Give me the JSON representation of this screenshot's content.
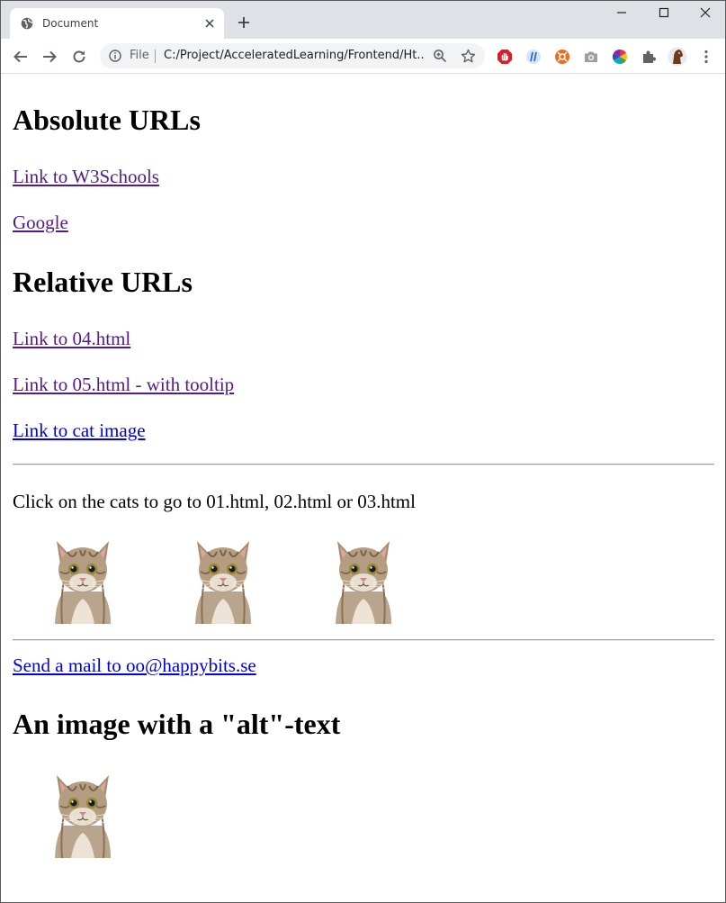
{
  "browser": {
    "tab_title": "Document",
    "scheme_label": "File",
    "url": "C:/Project/AcceleratedLearning/Frontend/Ht..."
  },
  "page": {
    "heading_absolute": "Absolute URLs",
    "link_w3schools": "Link to W3Schools",
    "link_google": "Google",
    "heading_relative": "Relative URLs",
    "link_04": "Link to 04.html",
    "link_05": "Link to 05.html - with tooltip",
    "link_cat": "Link to cat image",
    "cats_text": "Click on the cats to go to 01.html, 02.html or 03.html",
    "mail_link": "Send a mail to oo@happybits.se",
    "heading_alt": "An image with a \"alt\"-text"
  },
  "colors": {
    "visited_link": "#551a8b",
    "unvisited_link": "#0000ee",
    "chrome_bg": "#dee1e6"
  }
}
